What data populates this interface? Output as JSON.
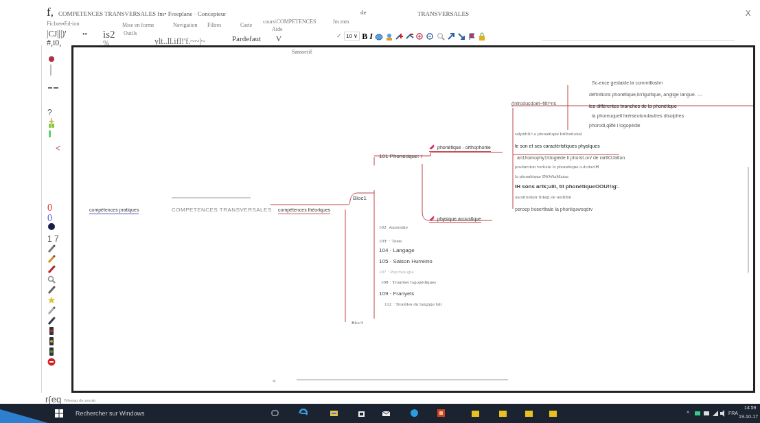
{
  "window": {
    "app_mark": "f,",
    "title_parts": [
      "COMPETENCES TRANSVERSALES fm• Freeplane · Concepteur",
      "de",
      "TRANSVERSALES"
    ],
    "close": "X"
  },
  "menu": [
    {
      "label": "Ficlxer▪Ed-ion"
    },
    {
      "label": "Mise en forme"
    },
    {
      "label": "Navigation"
    },
    {
      "label": "Filtres"
    },
    {
      "label": "Carte"
    },
    {
      "label": "cours\\COMPETENCES"
    },
    {
      "label": "fm.mm"
    },
    {
      "label": "Outils"
    },
    {
      "label": "Aide"
    }
  ],
  "toolbar": {
    "texts": [
      "|CJ|||)'",
      "••",
      "ìs2",
      "Pardefaut",
      "V",
      "#,i0,",
      "%",
      "ylt..ll.ifl!'f.~~|~",
      "Sansserif"
    ],
    "check": "✓",
    "font_size": "10",
    "font_size_caret": "∨",
    "bold": "B",
    "italic": "I"
  },
  "scroll_arrow": "<",
  "side_toolbar": [
    {
      "kind": "text",
      "text": "?"
    },
    {
      "kind": "text",
      "text": "<"
    },
    {
      "kind": "number",
      "text": "0",
      "color": "#e03030"
    },
    {
      "kind": "number",
      "text": "0",
      "color": "#6060e0"
    },
    {
      "kind": "text",
      "text": "1 7"
    }
  ],
  "mind_map": {
    "root": {
      "text": "COMPETENCES TRANSVERSALES",
      "children": [
        {
          "text": "compétences pratiques"
        },
        {
          "text": "compétences théoriques",
          "children": [
            {
              "text": "Bloc1",
              "children": [
                {
                  "text": "101 Phonédque: /",
                  "children": [
                    {
                      "text": "phonétique - orthophonie",
                      "children": [
                        {
                          "text": "(Introducdoet~fllt!^ns",
                          "children": [
                            {
                              "text": "Sc-ence gestalde la commttlosbn"
                            },
                            {
                              "text": "définitions phonétique,lin'lguifique, anglige langue. ---"
                            },
                            {
                              "text": "les différentes branches de la phonétique"
                            },
                            {
                              "text": "la phoreuquell hrérseotondautres disolplres"
                            },
                            {
                              "text": "phorodi,q8fe i logopédie"
                            }
                          ]
                        },
                        {
                          "text": "salphbli>.a phonétique Intlbational"
                        },
                        {
                          "text": "le son et ses caractéristiques physiques"
                        },
                        {
                          "text": "an1!lomophy1!dogiede li phorst.on/ de rarttOJation"
                        },
                        {
                          "text": "production verbale la phonétique a.dcdaciH"
                        },
                        {
                          "text": "la phonétique INtWiaMataa"
                        },
                        {
                          "text": "IH sons artk;ulil, til phonétiqueOOU!!ig:."
                        },
                        {
                          "text": "aaoitlrrelplr lidegl.de nudilbn"
                        },
                        {
                          "text": "peroep bosertbale la phonlquwoqdrv"
                        }
                      ]
                    },
                    {
                      "text": "physique acoustique"
                    }
                  ]
                },
                {
                  "text": "102· Anatomie"
                },
                {
                  "text": "103· · Teste"
                },
                {
                  "text": "104 · Langage"
                },
                {
                  "text": "105 · Saison Hurreino"
                },
                {
                  "text": "107 · Psychologie"
                },
                {
                  "text": "108 · Troubles logopédiques"
                },
                {
                  "text": "109 · Franyels"
                },
                {
                  "text": "112 · Troubles du langage lait"
                }
              ]
            },
            {
              "text": "Bloc3"
            }
          ]
        }
      ]
    }
  },
  "status_bar": {
    "mark": "r{eq",
    "label": "Niveau de zoom"
  },
  "taskbar": {
    "tray_arrow": "^",
    "search": "Rechercher sur Windows",
    "language": "FRA",
    "time": "14:59",
    "date": "19-10-17"
  }
}
